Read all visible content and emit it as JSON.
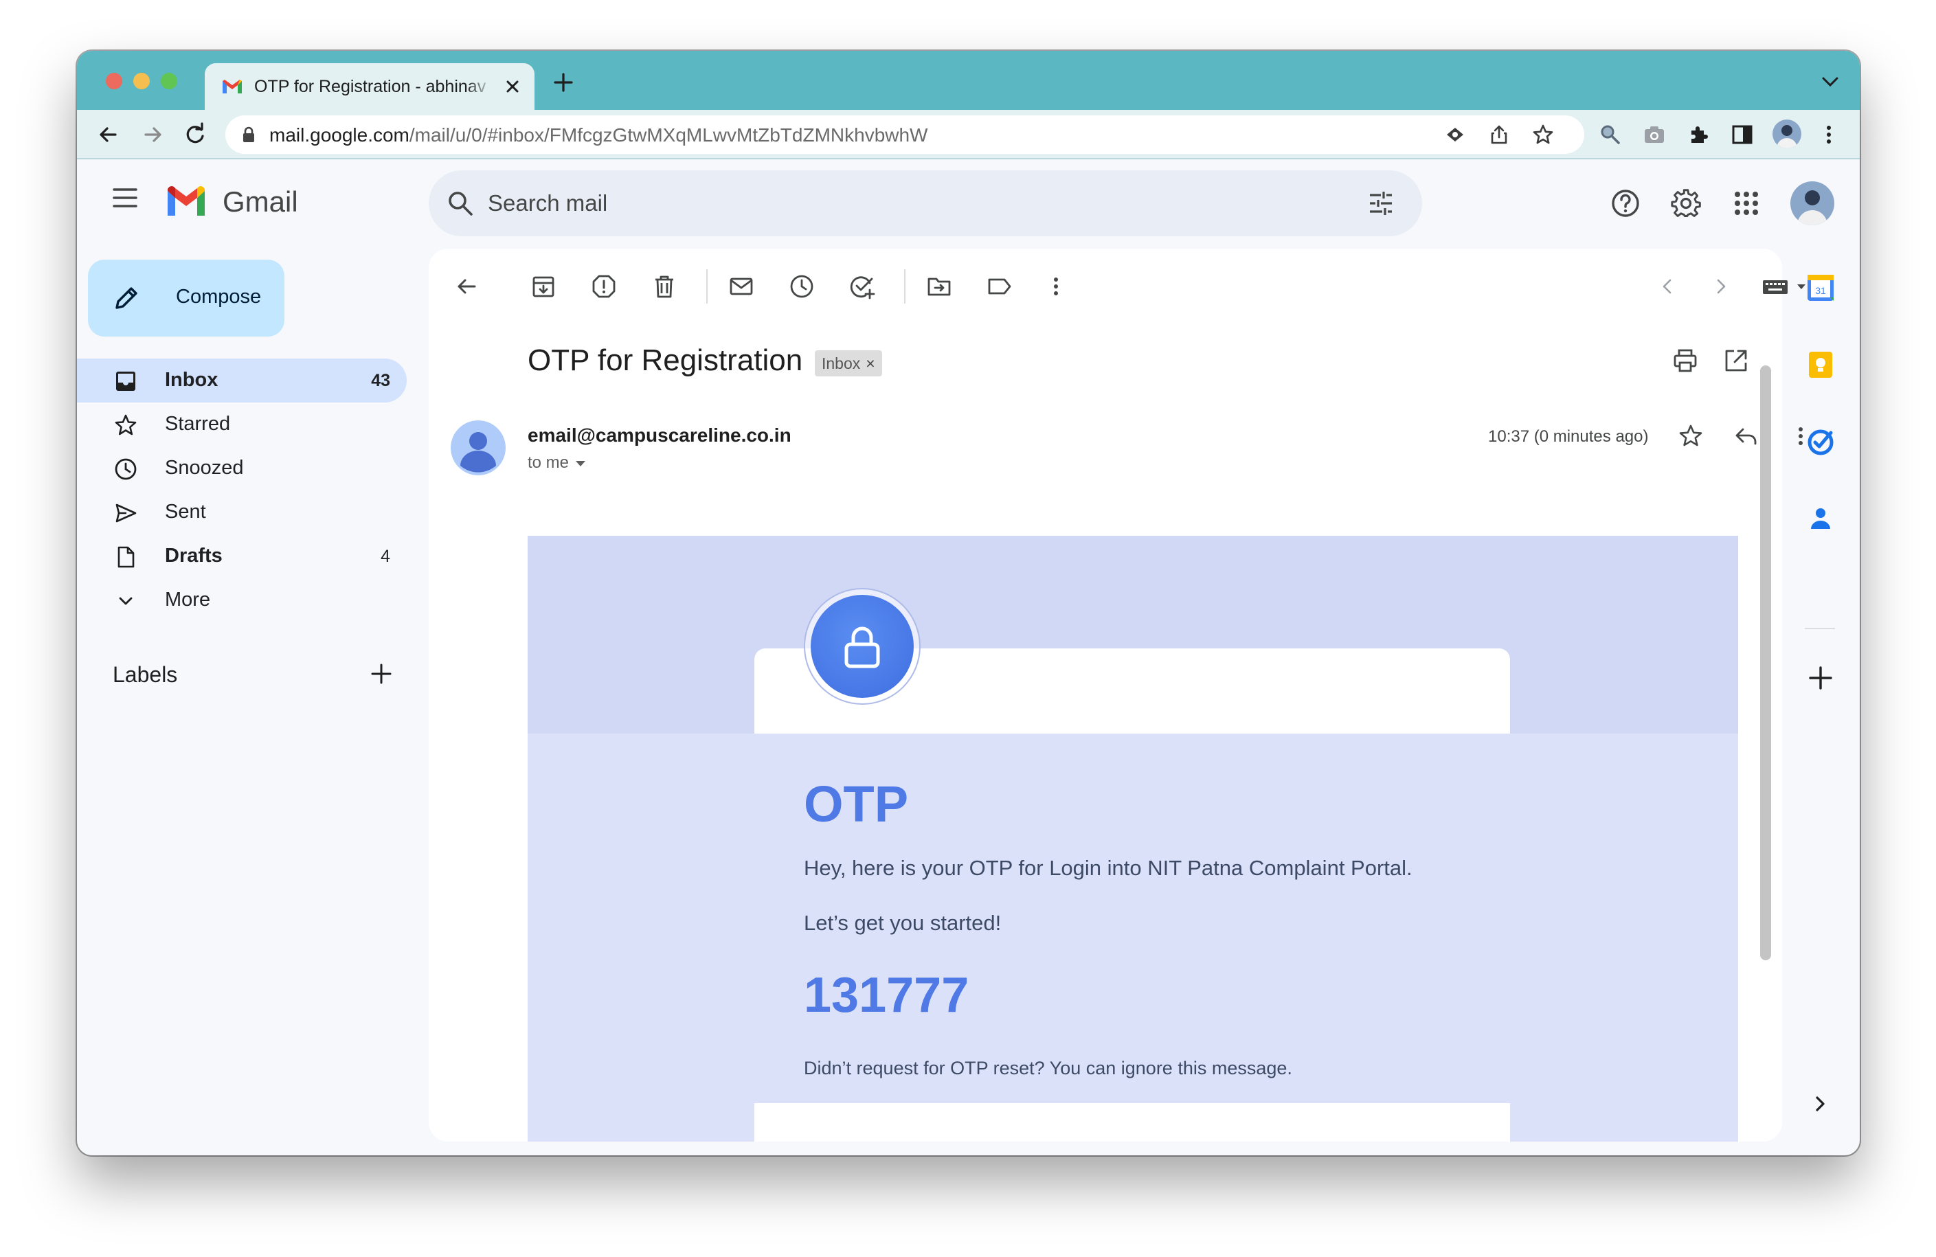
{
  "browser": {
    "tab_title": "OTP for Registration - abhinav",
    "url_host": "mail.google.com",
    "url_path": "/mail/u/0/#inbox/FMfcgzGtwMXqMLwvMtZbTdZMNkhvbwhW"
  },
  "gmail": {
    "logo_text": "Gmail",
    "search_placeholder": "Search mail"
  },
  "compose": {
    "label": "Compose"
  },
  "nav": {
    "items": [
      {
        "label": "Inbox",
        "count": "43",
        "icon": "inbox-icon"
      },
      {
        "label": "Starred",
        "count": "",
        "icon": "star-icon"
      },
      {
        "label": "Snoozed",
        "count": "",
        "icon": "clock-icon"
      },
      {
        "label": "Sent",
        "count": "",
        "icon": "send-icon"
      },
      {
        "label": "Drafts",
        "count": "4",
        "icon": "draft-icon"
      },
      {
        "label": "More",
        "count": "",
        "icon": "chevron-down-icon"
      }
    ],
    "labels_heading": "Labels"
  },
  "message": {
    "subject": "OTP for Registration",
    "label_chip": "Inbox",
    "chip_close": "×",
    "sender": "email@campuscareline.co.in",
    "to": "to me",
    "time": "10:37 (0 minutes ago)"
  },
  "email_body": {
    "heading": "OTP",
    "line1": "Hey, here is your OTP for Login into NIT Patna Complaint Portal.",
    "line2": "Let’s get you started!",
    "code": "131777",
    "note": "Didn’t request for OTP reset? You can ignore this message."
  },
  "colors": {
    "titlebar": "#5bb8c2",
    "toolbar": "#e3f1f3",
    "accent": "#4f79e4",
    "compose_bg": "#c2e7ff",
    "inbox_active_bg": "#d3e3fd"
  }
}
